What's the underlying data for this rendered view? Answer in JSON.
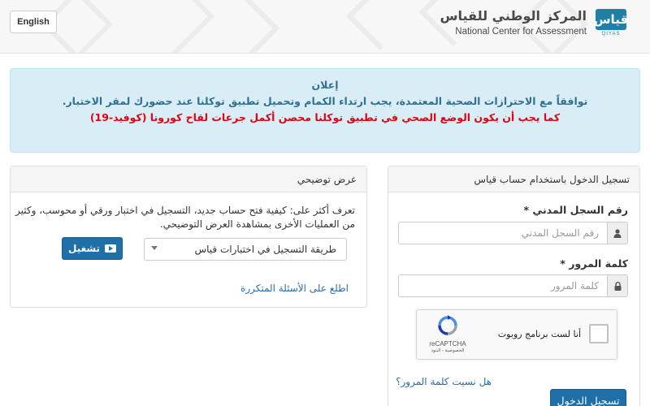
{
  "header": {
    "lang_button": "English",
    "brand_ar": "المركز الوطني للقياس",
    "brand_en": "National Center for Assessment",
    "logo_mark": "قياس",
    "logo_sub": "QIYAS",
    "background": "#f7f7f7"
  },
  "announcement": {
    "title": "إعلان",
    "line1": "توافقاً مع الاحترازات الصحية المعتمدة، يجب ارتداء الكمام وتحميل تطبيق توكلنا عند حضورك لمقر الاختبار.",
    "line2": "كما يجب أن يكون الوضع الصحي في تطبيق توكلنا محصن أكمل جرعات لقاح كورونا (كوفيد-19)",
    "bg_color": "#d9edf7",
    "text_color": "#31708f",
    "warning_color": "#e0000f"
  },
  "demo": {
    "heading": "عرض توضيحي",
    "description": "تعرف أكثر على: كيفية فتح حساب جديد، التسجيل في اختبار ورقي أو محوسب، وكثير من العمليات الأخرى بمشاهدة العرض التوضيحي.",
    "select_value": "طريقة التسجيل في اختبارات قياس",
    "play_button": "تشغيل",
    "faq_link": "اطلع على الأسئلة المتكررة"
  },
  "login": {
    "heading": "تسجيل الدخول باستخدام حساب قياس",
    "id_label": "رقم السجل المدني *",
    "id_placeholder": "رقم السجل المدني",
    "id_icon": "user-icon",
    "password_label": "كلمة المرور *",
    "password_placeholder": "كلمة المرور",
    "password_icon": "lock-icon",
    "recaptcha_label": "أنا لست برنامج روبوت",
    "recaptcha_brand": "reCAPTCHA",
    "recaptcha_terms": "الخصوصية - البنود",
    "forgot_link": "هل نسيت كلمة المرور؟",
    "submit_button": "تسجيل الدخول",
    "button_color": "#1f6fa8",
    "link_color": "#2a6cb0"
  }
}
